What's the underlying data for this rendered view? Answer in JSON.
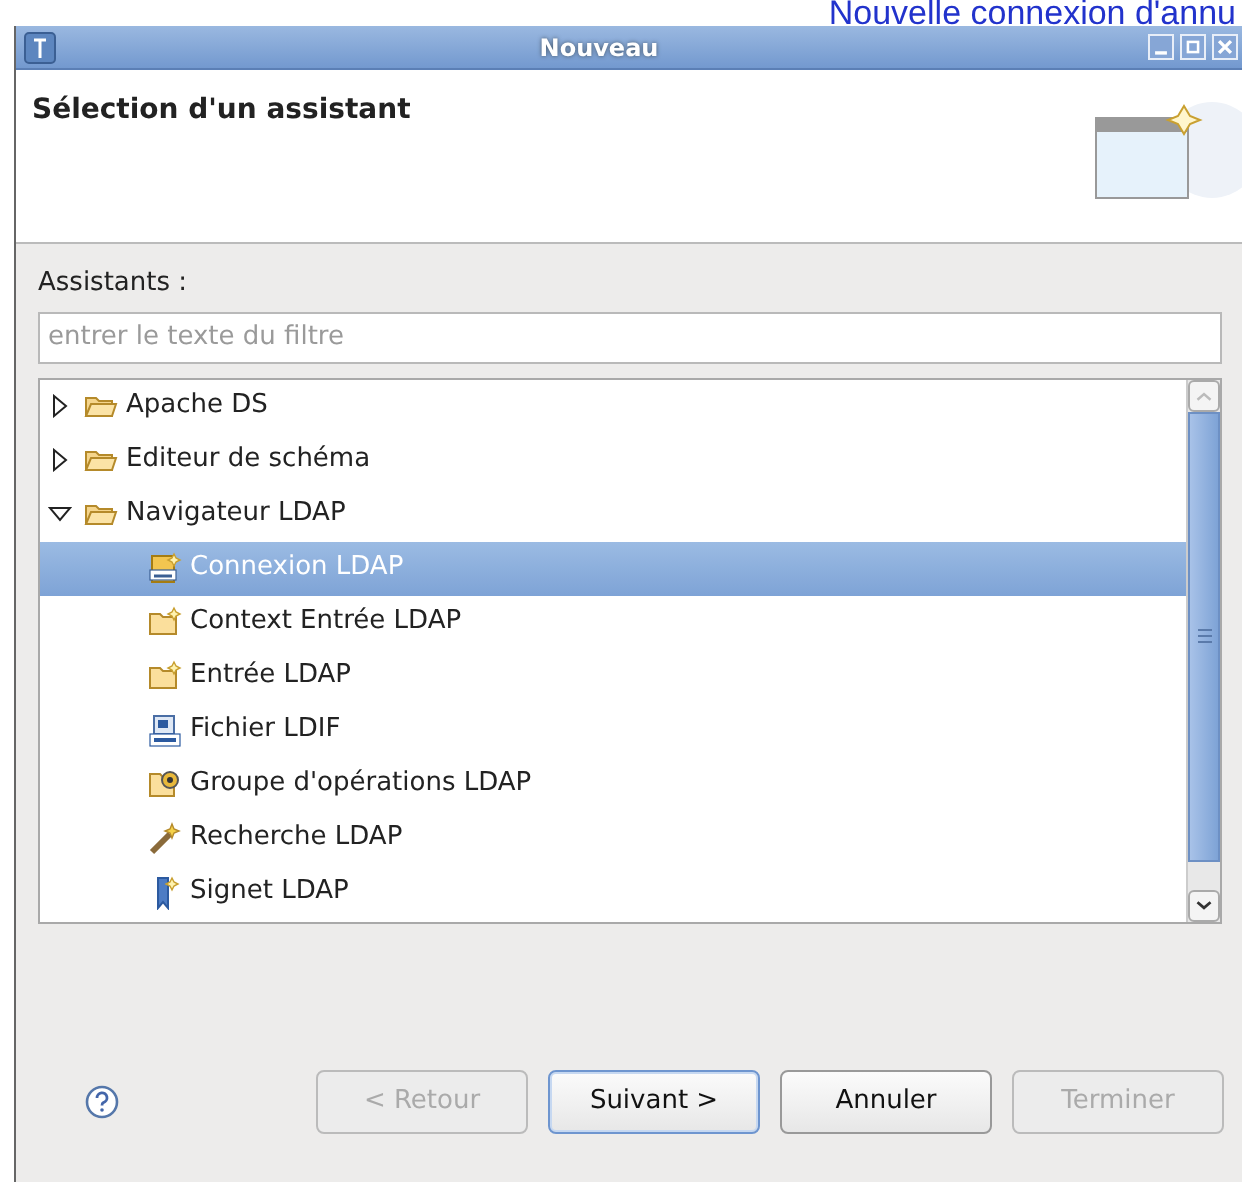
{
  "background_title": "Nouvelle connexion d'annu",
  "window": {
    "title": "Nouveau"
  },
  "header": {
    "title": "Sélection d'un assistant"
  },
  "filter": {
    "label": "Assistants :",
    "placeholder": "entrer le texte du filtre"
  },
  "tree": [
    {
      "label": "Apache DS",
      "kind": "folder",
      "expanded": false,
      "selected": false
    },
    {
      "label": "Editeur de schéma",
      "kind": "folder",
      "expanded": false,
      "selected": false
    },
    {
      "label": "Navigateur LDAP",
      "kind": "folder",
      "expanded": true,
      "selected": false,
      "children": [
        {
          "label": "Connexion LDAP",
          "kind": "connection",
          "selected": true
        },
        {
          "label": "Context Entrée LDAP",
          "kind": "newfolder",
          "selected": false
        },
        {
          "label": "Entrée LDAP",
          "kind": "newfolder",
          "selected": false
        },
        {
          "label": "Fichier LDIF",
          "kind": "ldif",
          "selected": false
        },
        {
          "label": "Groupe d'opérations LDAP",
          "kind": "group",
          "selected": false
        },
        {
          "label": "Recherche LDAP",
          "kind": "search",
          "selected": false
        },
        {
          "label": "Signet LDAP",
          "kind": "bookmark",
          "selected": false
        }
      ]
    }
  ],
  "buttons": [
    {
      "label": "< Retour",
      "disabled": true,
      "default": false
    },
    {
      "label": "Suivant >",
      "disabled": false,
      "default": true
    },
    {
      "label": "Annuler",
      "disabled": false,
      "default": false
    },
    {
      "label": "Terminer",
      "disabled": true,
      "default": false
    }
  ]
}
